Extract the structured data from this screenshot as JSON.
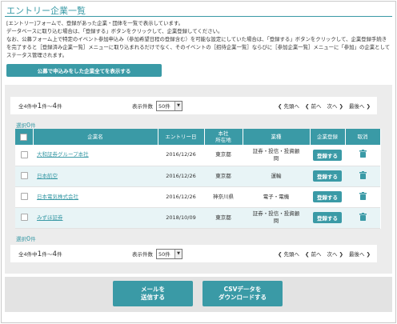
{
  "page": {
    "title": "エントリー企業一覧",
    "description": [
      "[エントリー]フォームで、登録があった企業・団体を一覧で表示しています。",
      "データベースに取り込む場合は、「登録する」ボタンをクリックして、企業登録してください。",
      "なお、公募フォーム上で特定のイベント参加申込み（参加希望日程の登録含む）を可能な設定にしていた場合は、「登録する」ボタンをクリックして、企業登録手続き",
      "を完了すると［登録済み企業一覧］メニューに取り込まれるだけでなく、そのイベントの［招待企業一覧］ならびに［参加企業一覧］メニューに「参加」の企業として",
      "ステータス管理されます。"
    ],
    "show_all_button": "公募で申込みをした企業全てを表示する"
  },
  "pager": {
    "total_prefix": "全4件中",
    "range_start": "1",
    "range_mid": "件～",
    "range_end": "4",
    "range_suffix": "件",
    "per_page_label": "表示件数",
    "per_page_value": "50件",
    "first": "先頭へ",
    "prev": "前へ",
    "next": "次へ",
    "last": "最後へ"
  },
  "selection": {
    "label": "選択",
    "count": "0",
    "unit": "件"
  },
  "table": {
    "headers": [
      "企業名",
      "エントリー日",
      "本社所在地",
      "業種",
      "企業登録",
      "取消"
    ],
    "hq_header_line1": "本社",
    "hq_header_line2": "所在地",
    "register_label": "登録する",
    "rows": [
      {
        "name": "大和証券グループ本社",
        "date": "2016/12/26",
        "location": "東京都",
        "industry_line1": "証券・投信・投資顧",
        "industry_line2": "問"
      },
      {
        "name": "日本航空",
        "date": "2016/12/26",
        "location": "東京都",
        "industry_line1": "運輸",
        "industry_line2": ""
      },
      {
        "name": "日本電気株式会社",
        "date": "2016/12/26",
        "location": "神奈川県",
        "industry_line1": "電子・電機",
        "industry_line2": ""
      },
      {
        "name": "みずほ証券",
        "date": "2018/10/09",
        "location": "東京都",
        "industry_line1": "証券・投信・投資顧",
        "industry_line2": "問"
      }
    ]
  },
  "actions": {
    "mail_button": "メールを\n送信する",
    "csv_button": "CSVデータを\nダウンロードする"
  },
  "colors": {
    "accent": "#3a9aa6",
    "panel": "#ececec",
    "row_alt": "#e8f4f6"
  },
  "icons": {
    "trash": "trash-icon",
    "nav_left": "chevron-left-icon",
    "nav_right": "chevron-right-icon",
    "select_arrow": "caret-down-icon"
  }
}
